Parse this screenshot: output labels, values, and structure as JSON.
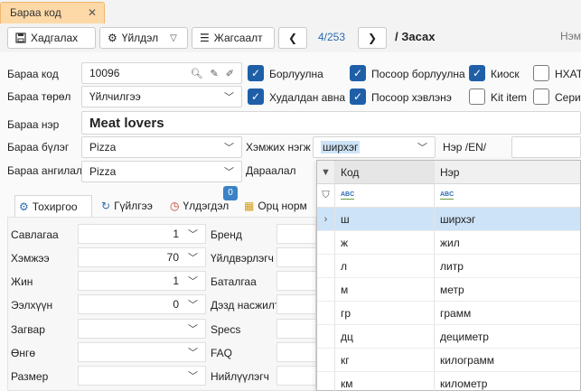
{
  "doc_tab": {
    "label": "Бараа код",
    "close": "✕"
  },
  "toolbar": {
    "save_label": "Хадгалах",
    "actions_label": "Үйлдэл",
    "list_label": "Жагсаалт",
    "prev": "❮",
    "next": "❯",
    "counter": "4/253",
    "title": "/ Засах",
    "right_cut": "Нэм"
  },
  "fields": {
    "code": {
      "label": "Бараа код",
      "value": "10096"
    },
    "type": {
      "label": "Бараа төрөл",
      "value": "Үйлчилгээ"
    },
    "name": {
      "label": "Бараа нэр",
      "value": "Meat lovers"
    },
    "group": {
      "label": "Бараа бүлэг",
      "value": "Pizza"
    },
    "class": {
      "label": "Бараа ангилал",
      "value": "Pizza"
    },
    "unit": {
      "label": "Хэмжих нэгж",
      "value": "ширхэг"
    },
    "name_en": {
      "label": "Нэр /EN/"
    },
    "sequence": {
      "label": "Дараалал"
    }
  },
  "checkboxes": [
    {
      "label": "Борлуулна",
      "checked": true
    },
    {
      "label": "Посоор борлуулна",
      "checked": true
    },
    {
      "label": "Киоск",
      "checked": true
    },
    {
      "label": "НХАТ",
      "checked": false
    },
    {
      "label": "Худалдан авна",
      "checked": true
    },
    {
      "label": "Посоор хэвлэнэ",
      "checked": true
    },
    {
      "label": "Kit item",
      "checked": false
    },
    {
      "label": "Сериал",
      "checked": false
    }
  ],
  "tabs": [
    {
      "label": "Тохиргоо"
    },
    {
      "label": "Гүйлгээ"
    },
    {
      "label": "Үлдэгдэл"
    },
    {
      "label": "Орц норм"
    }
  ],
  "tab_badge": "0",
  "settings_left": [
    {
      "label": "Савлагаа",
      "value": "1"
    },
    {
      "label": "Хэмжээ",
      "value": "70"
    },
    {
      "label": "Жин",
      "value": "1"
    },
    {
      "label": "Ээлхүүн",
      "value": "0"
    },
    {
      "label": "Загвар",
      "value": ""
    },
    {
      "label": "Өнгө",
      "value": ""
    },
    {
      "label": "Размер",
      "value": ""
    }
  ],
  "settings_right": [
    {
      "label": "Бренд"
    },
    {
      "label": "Үйлдвэрлэгч"
    },
    {
      "label": "Баталгаа"
    },
    {
      "label": "Дэзд насжилт"
    },
    {
      "label": "Specs"
    },
    {
      "label": "FAQ"
    },
    {
      "label": "Нийлүүлэгч"
    }
  ],
  "unit_dropdown": {
    "col_code": "Код",
    "col_name": "Нэр",
    "rows": [
      {
        "code": "ш",
        "name": "ширхэг"
      },
      {
        "code": "ж",
        "name": "жил"
      },
      {
        "code": "л",
        "name": "литр"
      },
      {
        "code": "м",
        "name": "метр"
      },
      {
        "code": "гр",
        "name": "грамм"
      },
      {
        "code": "дц",
        "name": "дециметр"
      },
      {
        "code": "кг",
        "name": "килограмм"
      },
      {
        "code": "км",
        "name": "километр"
      }
    ]
  }
}
